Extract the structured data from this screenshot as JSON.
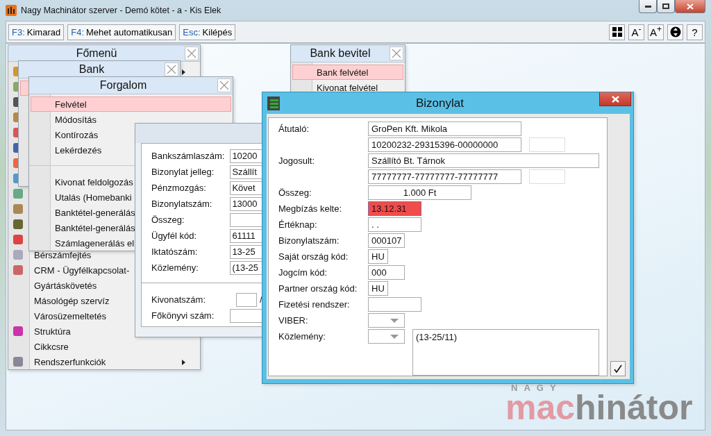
{
  "window": {
    "title": "Nagy Machinátor szerver - Demó kötet - a - Kis Elek"
  },
  "toolbar": {
    "actions": [
      {
        "key": "F3:",
        "label": "Kimarad"
      },
      {
        "key": "F4:",
        "label": "Mehet automatikusan"
      },
      {
        "key": "Esc:",
        "label": "Kilépés"
      }
    ],
    "tools": [
      {
        "kind": "grid"
      },
      {
        "kind": "text",
        "label": "A$^{-}$"
      },
      {
        "kind": "text",
        "label": "A$^{+}$"
      },
      {
        "kind": "circle"
      },
      {
        "kind": "text",
        "label": "?"
      }
    ]
  },
  "main_menu": {
    "title": "Főmenü",
    "first_row": {
      "submenu": true
    },
    "items": [
      {
        "label": "Bérszámfejtés",
        "submenu": false
      },
      {
        "label": "CRM - Ügyfélkapcsolat-",
        "submenu": false
      },
      {
        "label": "Gyártáskövetés",
        "submenu": false
      },
      {
        "label": "Másológép szervíz",
        "submenu": false
      },
      {
        "label": "Városüzemeltetés",
        "submenu": false
      },
      {
        "label": "Struktúra",
        "submenu": false
      },
      {
        "label": "Cikkcsre",
        "submenu": false
      },
      {
        "label": "Rendszerfunkciók",
        "submenu": true
      }
    ]
  },
  "bank_menu": {
    "title": "Bank",
    "items": [
      {
        "selected": true
      }
    ]
  },
  "traffic_menu": {
    "title": "Forgalom",
    "groups": [
      [
        {
          "label": "Felvétel",
          "selected": true
        },
        {
          "label": "Módosítás",
          "selected": false
        },
        {
          "label": "Kontírozás",
          "selected": false
        },
        {
          "label": "Lekérdezés",
          "selected": false
        }
      ],
      [
        {
          "label": "Kivonat feldolgozás",
          "selected": false
        },
        {
          "label": "Utalás (Homebanki",
          "selected": false
        },
        {
          "label": "Banktétel-generálás",
          "selected": false
        },
        {
          "label": "Banktétel-generálás",
          "selected": false
        },
        {
          "label": "Számlagenerálás el",
          "selected": false
        }
      ]
    ]
  },
  "bank_entry_menu": {
    "title": "Bank bevitel",
    "items": [
      {
        "label": "Bank felvétel",
        "selected": true
      },
      {
        "label": "Kivonat felvétel",
        "selected": false
      }
    ]
  },
  "back_form": {
    "groups": [
      [
        {
          "label": "Bankszámlaszám:",
          "value": "10200"
        },
        {
          "label": "Bizonylat jelleg:",
          "value": "Szállít"
        },
        {
          "label": "Pénzmozgás:",
          "value": "Követ"
        },
        {
          "label": "Bizonylatszám:",
          "value": "13000"
        },
        {
          "label": "Összeg:"
        },
        {
          "label": "Ügyfél kód:",
          "value": "61111"
        },
        {
          "label": "Iktatószám:",
          "value": "13-25"
        },
        {
          "label": "Közlemény:",
          "value": "(13-25"
        }
      ],
      [
        {
          "label": "Kivonatszám:",
          "split": "/"
        },
        {
          "label": "Főkönyvi szám:"
        }
      ]
    ]
  },
  "dialog": {
    "title": "Bizonylat",
    "rows": [
      {
        "label": "Átutaló:",
        "inputs": [
          {
            "kind": "text",
            "value": "GroPen Kft. Mikola"
          }
        ]
      },
      {
        "inputs": [
          {
            "kind": "text",
            "value": "10200232-29315396-00000000"
          },
          {
            "kind": "spare"
          }
        ]
      },
      {
        "label": "Jogosult:",
        "inputs": [
          {
            "kind": "text",
            "value": "Szállító Bt. Tárnok"
          }
        ]
      },
      {
        "inputs": [
          {
            "kind": "text",
            "value": "77777777-77777777-77777777"
          },
          {
            "kind": "spare"
          }
        ]
      },
      {
        "label": "Összeg:",
        "inputs": [
          {
            "kind": "amount",
            "value": "1.000 Ft"
          }
        ]
      },
      {
        "label": "Megbízás kelte:",
        "inputs": [
          {
            "kind": "text",
            "value": "13.12.31",
            "invalid": true
          }
        ]
      },
      {
        "label": "Értéknap:",
        "inputs": [
          {
            "kind": "text",
            "value": " . ."
          }
        ]
      },
      {
        "label": "Bizonylatszám:",
        "inputs": [
          {
            "kind": "text",
            "value": "000107"
          }
        ]
      },
      {
        "label": "Saját ország kód:",
        "inputs": [
          {
            "kind": "text",
            "value": "HU"
          }
        ]
      },
      {
        "label": "Jogcím kód:",
        "inputs": [
          {
            "kind": "text",
            "value": "000"
          }
        ]
      },
      {
        "label": "Partner ország kód:",
        "inputs": [
          {
            "kind": "text",
            "value": "HU"
          }
        ]
      },
      {
        "label": "Fizetési rendszer:",
        "inputs": [
          {
            "kind": "text"
          }
        ]
      },
      {
        "label": "VIBER:",
        "inputs": [
          {
            "kind": "dropdown"
          }
        ]
      },
      {
        "label": "Közlemény:",
        "inputs": [
          {
            "kind": "dropdown"
          },
          {
            "kind": "memo",
            "value": "(13-25/11)"
          }
        ]
      }
    ]
  },
  "logo": {
    "small": "NAGY",
    "accent": "mac",
    "rest": "hinátor"
  }
}
